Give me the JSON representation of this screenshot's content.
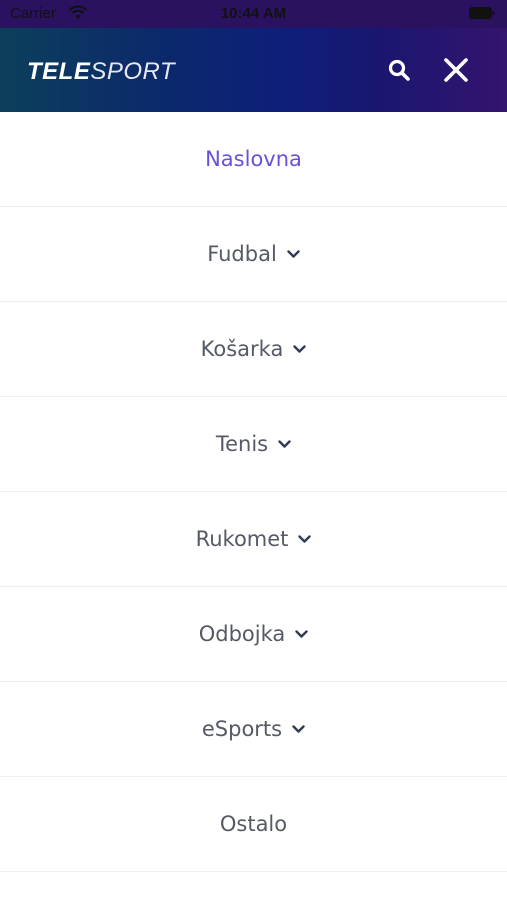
{
  "status_bar": {
    "carrier": "Carrier",
    "time": "10:44 AM"
  },
  "header": {
    "logo_bold": "TELE",
    "logo_light": "SPORT",
    "icons": [
      "search-icon",
      "close-icon"
    ]
  },
  "menu": {
    "items": [
      {
        "label": "Naslovna",
        "active": true,
        "expandable": false
      },
      {
        "label": "Fudbal",
        "active": false,
        "expandable": true
      },
      {
        "label": "Košarka",
        "active": false,
        "expandable": true
      },
      {
        "label": "Tenis",
        "active": false,
        "expandable": true
      },
      {
        "label": "Rukomet",
        "active": false,
        "expandable": true
      },
      {
        "label": "Odbojka",
        "active": false,
        "expandable": true
      },
      {
        "label": "eSports",
        "active": false,
        "expandable": true
      },
      {
        "label": "Ostalo",
        "active": false,
        "expandable": false
      }
    ]
  },
  "colors": {
    "active": "#6a52d8",
    "text": "#555a66",
    "header_start": "#0b3f5c",
    "header_end": "#34146e"
  }
}
